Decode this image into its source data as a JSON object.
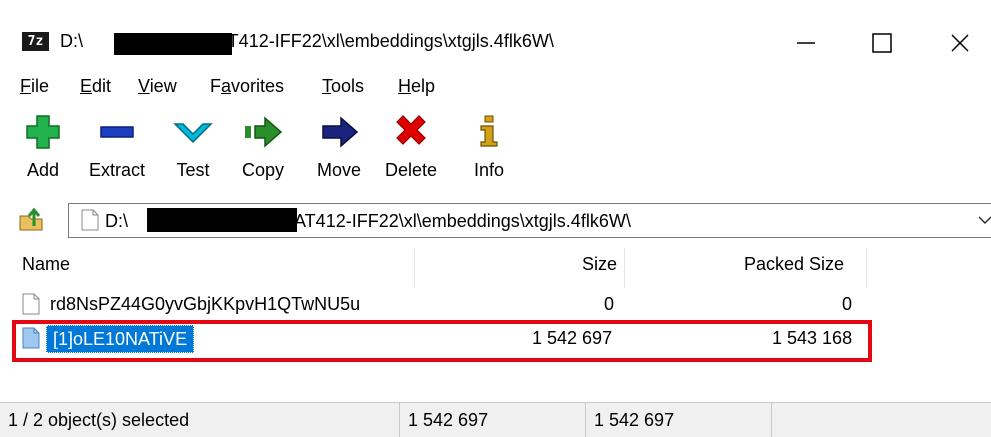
{
  "window": {
    "app_icon_text": "7z",
    "title_prefix": "D:\\",
    "title_suffix": "GAT412-IFF22\\xl\\embeddings\\xtgjls.4flk6W\\",
    "controls": [
      "minimize-icon",
      "maximize-icon",
      "close-icon"
    ]
  },
  "menu": [
    {
      "ul": "F",
      "rest": "ile"
    },
    {
      "ul": "E",
      "rest": "dit"
    },
    {
      "ul": "V",
      "rest": "iew"
    },
    {
      "pre": "F",
      "ul": "a",
      "rest": "vorites"
    },
    {
      "ul": "T",
      "rest": "ools"
    },
    {
      "ul": "H",
      "rest": "elp"
    }
  ],
  "toolbar": {
    "add": "Add",
    "extract": "Extract",
    "test": "Test",
    "copy": "Copy",
    "move": "Move",
    "delete": "Delete",
    "info": "Info",
    "icons": {
      "add": "plus-icon",
      "extract": "minus-icon",
      "test": "check-chevron-icon",
      "copy": "copy-arrow-icon",
      "move": "move-arrow-icon",
      "delete": "delete-x-icon",
      "info": "info-icon"
    },
    "colors": {
      "add": "#22b14c",
      "extract": "#1e3fbf",
      "test": "#00b7d8",
      "copy": "#2a8f2a",
      "move": "#1a237e",
      "delete": "#e00000",
      "info": "#d4a017"
    }
  },
  "address": {
    "prefix": "D:\\",
    "suffix": "GAT412-IFF22\\xl\\embeddings\\xtgjls.4flk6W\\"
  },
  "list": {
    "columns": {
      "name": "Name",
      "size": "Size",
      "packed": "Packed Size"
    },
    "rows": [
      {
        "name": "rd8NsPZ44G0yvGbjKKpvH1QTwNU5u",
        "size": "0",
        "packed": "0",
        "selected": false
      },
      {
        "name": "[1]oLE10NATiVE",
        "size": "1 542 697",
        "packed": "1 543 168",
        "selected": true
      }
    ]
  },
  "status": {
    "selection": "1 / 2 object(s) selected",
    "size": "1 542 697",
    "packed": "1 542 697"
  },
  "colors": {
    "selection": "#0078d7",
    "highlight_box": "#e30613"
  }
}
